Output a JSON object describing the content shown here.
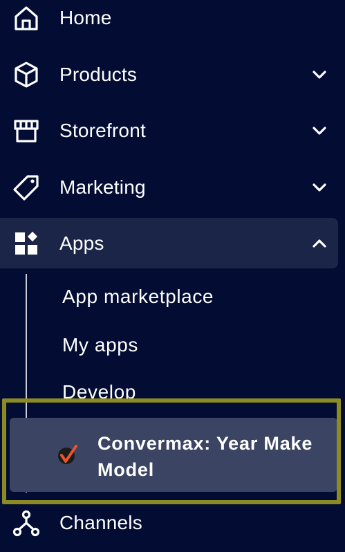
{
  "nav": {
    "items": [
      {
        "label": "Home",
        "icon": "home-icon"
      },
      {
        "label": "Products",
        "icon": "cube-icon",
        "expand": "chevron-down"
      },
      {
        "label": "Storefront",
        "icon": "storefront-icon",
        "expand": "chevron-down"
      },
      {
        "label": "Marketing",
        "icon": "tag-icon",
        "expand": "chevron-down"
      },
      {
        "label": "Apps",
        "icon": "apps-icon",
        "expand": "chevron-up",
        "active": true
      },
      {
        "label": "Channels",
        "icon": "channels-icon"
      }
    ],
    "apps_sub": {
      "items": [
        {
          "label": "App marketplace"
        },
        {
          "label": "My apps"
        },
        {
          "label": "Develop"
        }
      ],
      "selected_app": {
        "label": "Convermax: Year Make Model",
        "icon": "convermax-logo-icon"
      }
    }
  },
  "colors": {
    "background": "#030d33",
    "active_bg": "#1a2547",
    "selected_bg": "#3b4563",
    "highlight_border": "#8b8a24",
    "text": "#ffffff",
    "logo_orange": "#e8562a"
  }
}
